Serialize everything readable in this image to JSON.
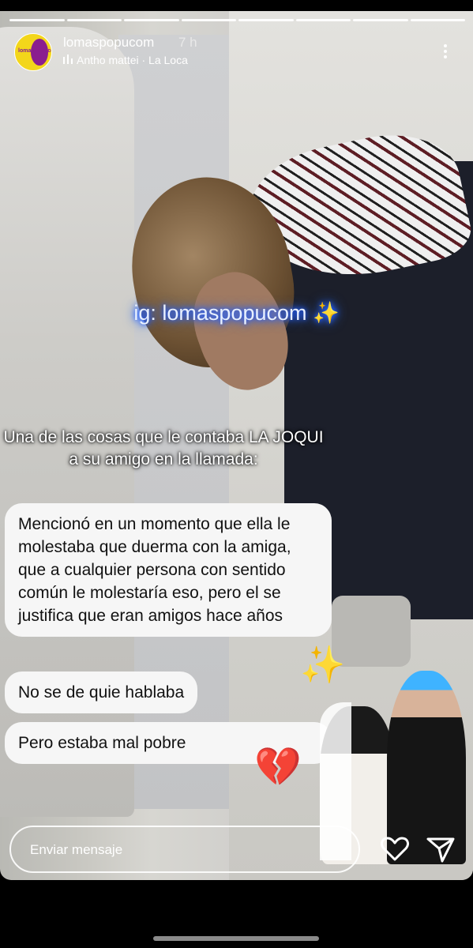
{
  "story": {
    "progress_segments": 8,
    "username": "lomaspopucom",
    "time_ago": "7 h",
    "music": "Antho mattei · La Loca",
    "avatar_text": "lomaspopucom"
  },
  "overlay": {
    "ig_tag": "ig: lomaspopucom ✨",
    "caption": "Una de las cosas que le contaba LA JOQUI a su amigo en la llamada:",
    "messages": [
      "Mencionó en un momento que ella le molestaba que duerma con la amiga, que a cualquier persona con sentido común le molestaría eso, pero el se justifica que eran amigos hace años",
      "No se de quie hablaba",
      "Pero estaba mal pobre"
    ],
    "broken_heart": "💔",
    "sparkles": "✨"
  },
  "reply": {
    "placeholder": "Enviar mensaje"
  },
  "colors": {
    "glow": "#1f5bff",
    "bubble": "#f6f6f6",
    "avatar_bg": "#f3d61a"
  }
}
